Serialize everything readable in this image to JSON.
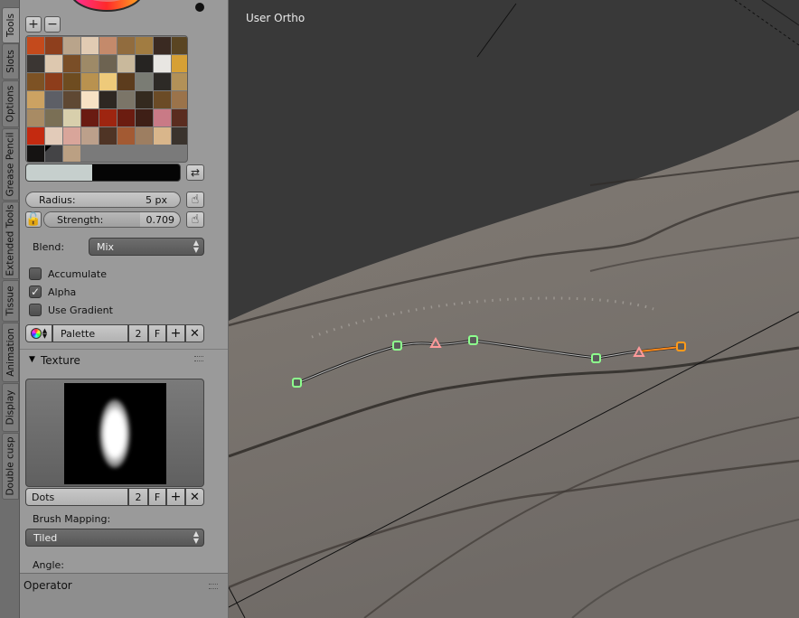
{
  "tabs": [
    "Tools",
    "Slots",
    "Options",
    "Grease Pencil",
    "Extended Tools",
    "Tissue",
    "Animation",
    "Display",
    "Double cusp"
  ],
  "viewport": {
    "label": "User Ortho"
  },
  "brush": {
    "radius_label": "Radius:",
    "radius_value": "5 px",
    "strength_label": "Strength:",
    "strength_value": "0.709",
    "strength_fraction": 0.709,
    "blend_label": "Blend:",
    "blend_value": "Mix",
    "accumulate_label": "Accumulate",
    "accumulate_checked": false,
    "alpha_label": "Alpha",
    "alpha_checked": true,
    "use_gradient_label": "Use Gradient",
    "use_gradient_checked": false,
    "palette_name": "Palette",
    "palette_users": "2",
    "palette_fake": "F"
  },
  "palette_colors": [
    [
      "#c44a1c",
      "#8e3f1d",
      "#b9a48b",
      "#e1cbb3",
      "#c48a6b",
      "#916c3e",
      "#a17c41",
      "#3a2a22",
      "#5a4522"
    ],
    [
      "#3b3633",
      "#ddc8af",
      "#7a4e27",
      "#9e8a67",
      "#6d6351",
      "#c9b99c",
      "#262422",
      "#e8e6e2",
      "#d6a035"
    ],
    [
      "#7d5224",
      "#8d3d1b",
      "#6e4c20",
      "#b9924f",
      "#eeca7a",
      "#5c3c1d",
      "#7a7c74",
      "#2d2a26",
      "#b29158"
    ],
    [
      "#cca262",
      "#5d5f66",
      "#5f4833",
      "#f6e1c4",
      "#2e2722",
      "#7b7568",
      "#342a1f",
      "#6b4b26",
      "#9b734a"
    ],
    [
      "#a88b64",
      "#7a6f55",
      "#d8cfac",
      "#6a1b12",
      "#9e2510",
      "#6b1c10",
      "#3e1f16",
      "#c97a86",
      "#5a2c1f"
    ],
    [
      "#c42a10",
      "#e2cbb9",
      "#d9a59a",
      "#bca08b",
      "#4f3425",
      "#a35a33",
      "#9d7e61",
      "#d9b68b",
      "#3a332d"
    ],
    [
      "#151312",
      "#444446",
      "#bba083"
    ]
  ],
  "color_bar": {
    "fill_fraction": 0.43
  },
  "texture": {
    "header": "Texture",
    "name": "Dots",
    "users": "2",
    "fake": "F",
    "mapping_label": "Brush Mapping:",
    "mapping_value": "Tiled",
    "angle_label": "Angle:"
  },
  "operator": {
    "header": "Operator"
  }
}
